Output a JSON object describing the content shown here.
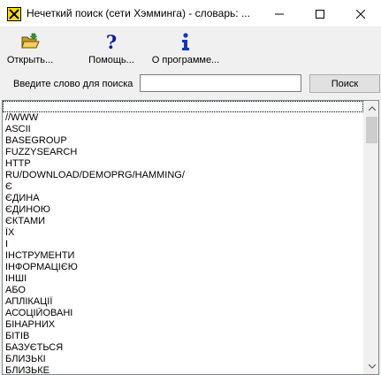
{
  "window": {
    "title": "Нечеткий поиск (сети Хэмминга) - словарь: ..."
  },
  "toolbar": {
    "open_label": "Открыть...",
    "help_label": "Помощь...",
    "about_label": "О программе..."
  },
  "search": {
    "label": "Введите слово для поиска",
    "value": "",
    "placeholder": "",
    "button_label": "Поиск"
  },
  "words": [
    "",
    "//WWW",
    "ASCII",
    "BASEGROUP",
    "FUZZYSEARCH",
    "HTTP",
    "RU/DOWNLOAD/DEMOPRG/HAMMING/",
    "Є",
    "ЄДИНА",
    "ЄДИНОЮ",
    "ЄКТАМИ",
    "ЇХ",
    "І",
    "ІНСТРУМЕНТИ",
    "ІНФОРМАЦІЄЮ",
    "ІНШІ",
    "АБО",
    "АПЛІКАЦІЇ",
    "АСОЦІЙОВАНІ",
    "БІНАРНИХ",
    "БІТІВ",
    "БАЗУЄТЬСЯ",
    "БЛИЗЬКІ",
    "БЛИЗЬКЕ"
  ],
  "colors": {
    "help_icon": "#0a1f9e",
    "info_icon": "#1533c9",
    "folder_icon": "#e8c04a"
  }
}
